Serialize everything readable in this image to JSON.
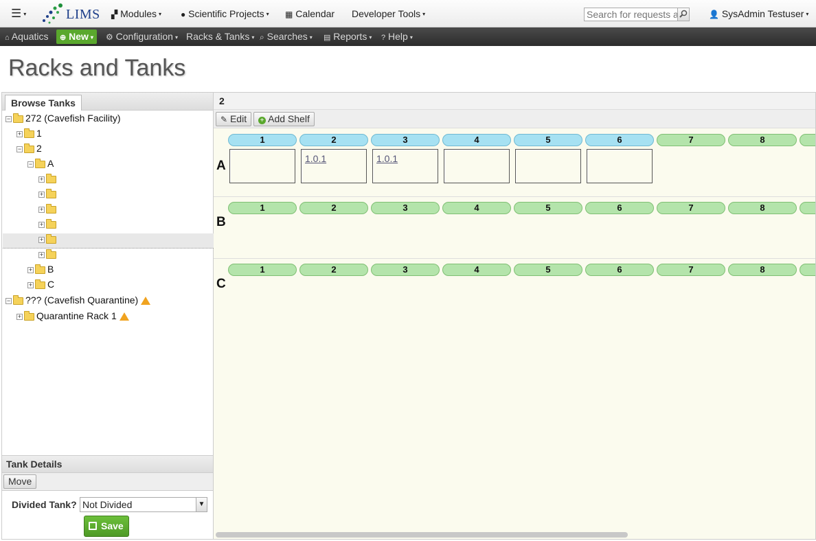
{
  "topbar": {
    "menu_caret": "▾",
    "logo_text": "LIMS",
    "modules": "Modules",
    "projects": "Scientific Projects",
    "calendar": "Calendar",
    "devtools": "Developer Tools",
    "search_placeholder": "Search for requests a",
    "user": "SysAdmin Testuser"
  },
  "navbar": {
    "aquatics": "Aquatics",
    "new": "New",
    "configuration": "Configuration",
    "racks": "Racks & Tanks",
    "searches": "Searches",
    "reports": "Reports",
    "help": "Help"
  },
  "page_title": "Racks and Tanks",
  "tree": {
    "tab": "Browse Tanks",
    "nodes": [
      {
        "label": "272 (Cavefish Facility)",
        "toggle": "−"
      },
      {
        "label": "1",
        "toggle": "+"
      },
      {
        "label": "2",
        "toggle": "−"
      },
      {
        "label": "A",
        "toggle": "−"
      },
      {
        "label": "",
        "toggle": "+"
      },
      {
        "label": "",
        "toggle": "+"
      },
      {
        "label": "",
        "toggle": "+"
      },
      {
        "label": "",
        "toggle": "+"
      },
      {
        "label": "",
        "toggle": "+"
      },
      {
        "label": "",
        "toggle": "+"
      },
      {
        "label": "B",
        "toggle": "+"
      },
      {
        "label": "C",
        "toggle": "+"
      },
      {
        "label": "??? (Cavefish Quarantine)",
        "toggle": "−"
      },
      {
        "label": "Quarantine Rack 1",
        "toggle": "+"
      }
    ]
  },
  "details": {
    "title": "Tank Details",
    "move": "Move",
    "divided_label": "Divided Tank?",
    "divided_value": "Not Divided",
    "save": "Save"
  },
  "rack": {
    "title": "2",
    "edit": "Edit",
    "add_shelf": "Add Shelf",
    "shelves": [
      {
        "label": "A",
        "positions": [
          "1",
          "2",
          "3",
          "4",
          "5",
          "6",
          "7",
          "8"
        ],
        "tanks": [
          "",
          "1.0.1",
          "1.0.1",
          "",
          "",
          ""
        ]
      },
      {
        "label": "B",
        "positions": [
          "1",
          "2",
          "3",
          "4",
          "5",
          "6",
          "7",
          "8"
        ]
      },
      {
        "label": "C",
        "positions": [
          "1",
          "2",
          "3",
          "4",
          "5",
          "6",
          "7",
          "8"
        ]
      }
    ]
  },
  "colors": {
    "new_green": "#5aa82d",
    "occupied_blue": "#a6e1f2",
    "empty_green": "#b4e4ab"
  }
}
